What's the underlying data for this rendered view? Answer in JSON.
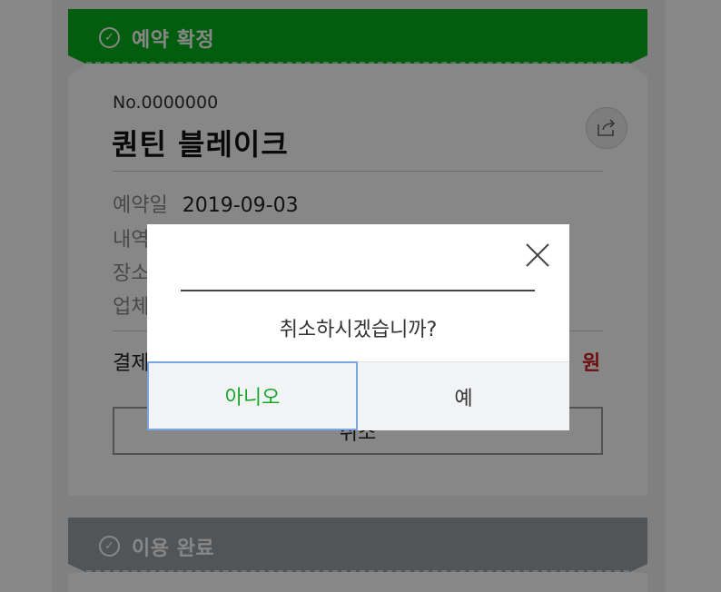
{
  "cards": [
    {
      "status_title": "예약 확정",
      "status_icon": "check-circle-icon",
      "status_color": "#04b01c"
    },
    {
      "status_title": "이용 완료",
      "status_icon": "check-circle-icon",
      "status_color": "#9aa0a5"
    }
  ],
  "booking": {
    "number": "No.0000000",
    "name": "퀀틴 블레이크",
    "rows": [
      {
        "label": "예약일",
        "value": "2019-09-03"
      },
      {
        "label": "내역",
        "value": ""
      },
      {
        "label": "장소",
        "value": ""
      },
      {
        "label": "업체",
        "value": ""
      }
    ],
    "payment_label": "결제",
    "payment_unit": "원",
    "cancel_label": "취소"
  },
  "modal": {
    "message": "취소하시겠습니까?",
    "no_label": "아니오",
    "yes_label": "예"
  },
  "colors": {
    "accent_green": "#04b01c",
    "price_red": "#d21c1c",
    "focus_blue": "#7aa7e0"
  }
}
